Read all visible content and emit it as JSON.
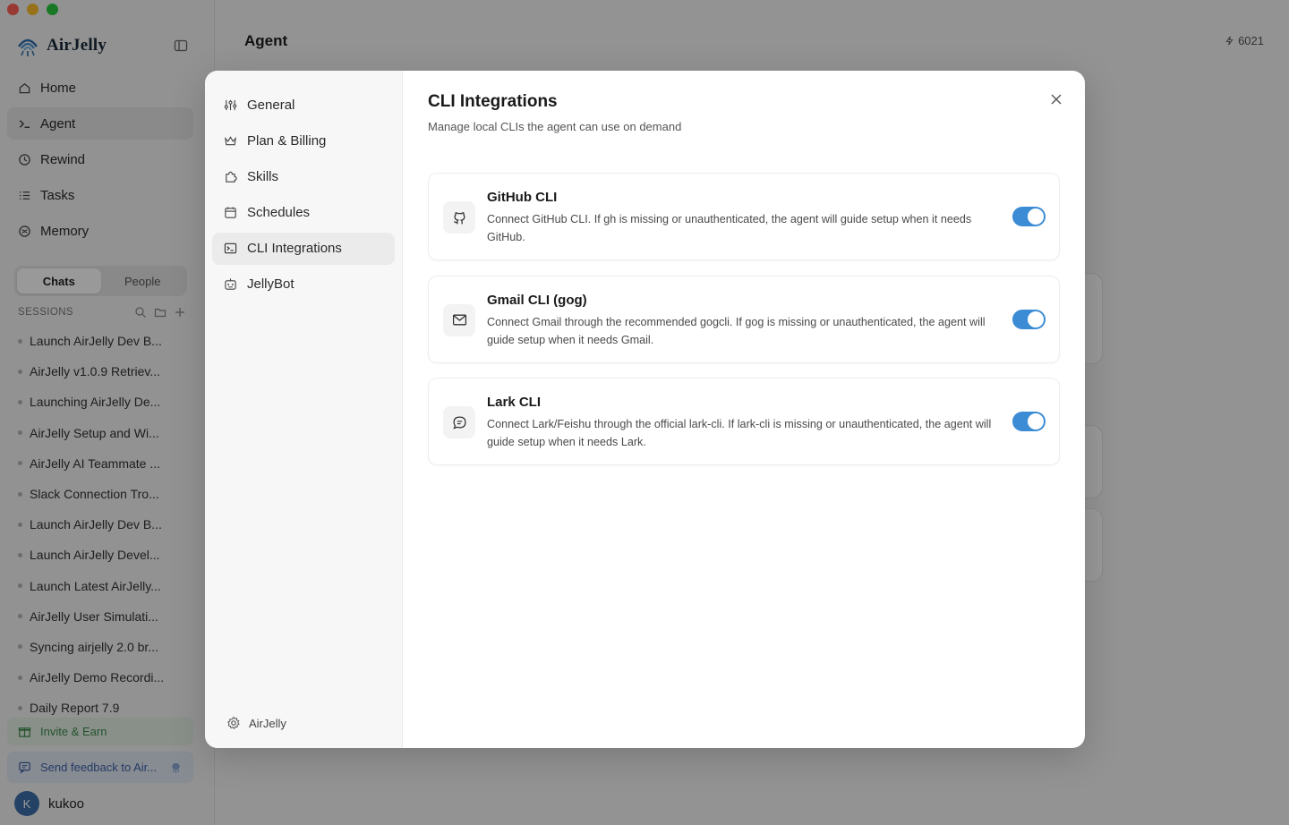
{
  "app": {
    "brand": "AirJelly",
    "nav": [
      {
        "label": "Home",
        "icon": "home-icon"
      },
      {
        "label": "Agent",
        "icon": "terminal-icon"
      },
      {
        "label": "Rewind",
        "icon": "clock-icon"
      },
      {
        "label": "Tasks",
        "icon": "list-icon"
      },
      {
        "label": "Memory",
        "icon": "brain-icon"
      }
    ],
    "active_nav": "Agent",
    "segments": [
      "Chats",
      "People"
    ],
    "active_segment": "Chats",
    "sessions_label": "SESSIONS",
    "sessions": [
      "Launch AirJelly Dev B...",
      "AirJelly v1.0.9 Retriev...",
      "Launching AirJelly De...",
      "AirJelly Setup and Wi...",
      "AirJelly AI Teammate ...",
      "Slack Connection Tro...",
      "Launch AirJelly Dev B...",
      "Launch AirJelly Devel...",
      "Launch Latest AirJelly...",
      "AirJelly User Simulati...",
      "Syncing airjelly 2.0 br...",
      "AirJelly Demo Recordi...",
      "Daily Report 7.9"
    ],
    "invite_label": "Invite & Earn",
    "feedback_label": "Send feedback to Air...",
    "user": {
      "initial": "K",
      "name": "kukoo"
    },
    "page_title": "Agent",
    "credits": "6021"
  },
  "settings": {
    "nav": [
      {
        "label": "General",
        "icon": "sliders-icon"
      },
      {
        "label": "Plan & Billing",
        "icon": "crown-icon"
      },
      {
        "label": "Skills",
        "icon": "puzzle-icon"
      },
      {
        "label": "Schedules",
        "icon": "calendar-icon"
      },
      {
        "label": "CLI Integrations",
        "icon": "terminal-box-icon"
      },
      {
        "label": "JellyBot",
        "icon": "bot-icon"
      }
    ],
    "active": "CLI Integrations",
    "footer_label": "AirJelly",
    "title": "CLI Integrations",
    "subtitle": "Manage local CLIs the agent can use on demand",
    "integrations": [
      {
        "name": "GitHub CLI",
        "description": "Connect GitHub CLI. If gh is missing or unauthenticated, the agent will guide setup when it needs GitHub.",
        "icon": "github-icon",
        "enabled": true
      },
      {
        "name": "Gmail CLI (gog)",
        "description": "Connect Gmail through the recommended gogcli. If gog is missing or unauthenticated, the agent will guide setup when it needs Gmail.",
        "icon": "mail-icon",
        "enabled": true
      },
      {
        "name": "Lark CLI",
        "description": "Connect Lark/Feishu through the official lark-cli. If lark-cli is missing or unauthenticated, the agent will guide setup when it needs Lark.",
        "icon": "chat-bubble-icon",
        "enabled": true
      }
    ],
    "accent_color": "#3b8cd5"
  }
}
